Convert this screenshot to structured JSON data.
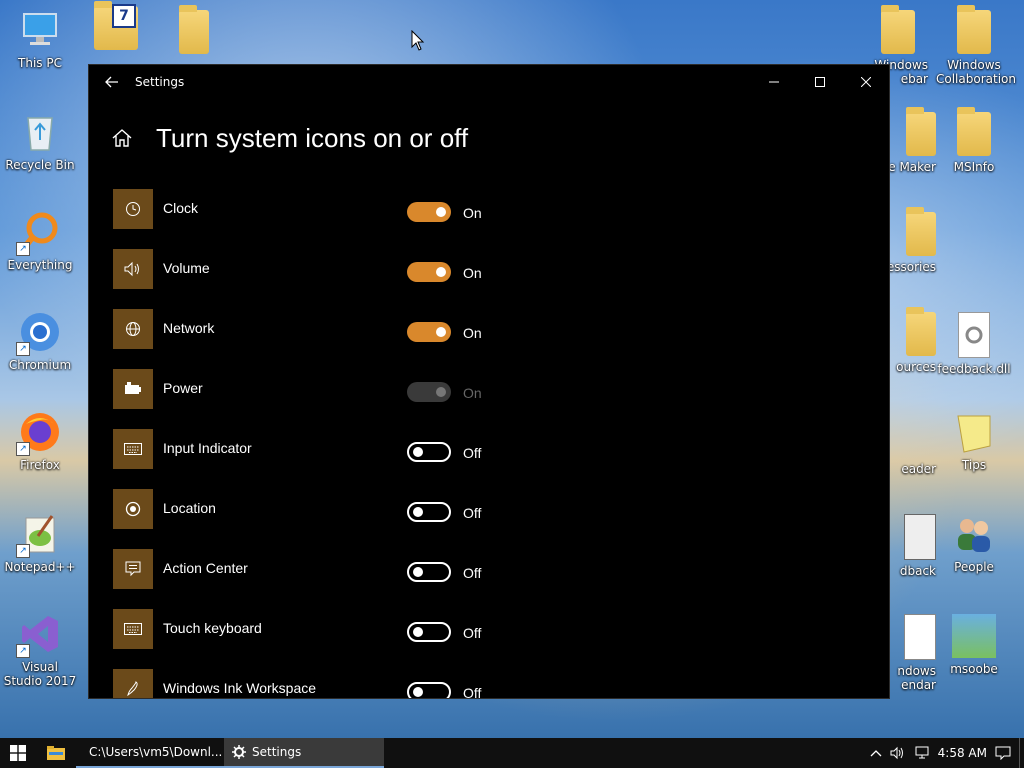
{
  "desktop": {
    "icons_left": [
      {
        "label": "This PC"
      },
      {
        "label": "Recycle Bin"
      },
      {
        "label": "Everything"
      },
      {
        "label": "Chromium"
      },
      {
        "label": "Firefox"
      },
      {
        "label": "Notepad++"
      },
      {
        "label": "Visual Studio 2017"
      }
    ],
    "icons_right": [
      {
        "label": "Windows Sidebar",
        "visible_text": "Windows\nebar"
      },
      {
        "label": "Windows Collaboration"
      },
      {
        "label": "Movie Maker",
        "visible_text": "e Maker"
      },
      {
        "label": "MSInfo"
      },
      {
        "label": "Accessories",
        "visible_text": "essories"
      },
      {
        "label": "Resources",
        "visible_text": "ources"
      },
      {
        "label": "feedback.dll"
      },
      {
        "label": "Reader",
        "visible_text": "eader"
      },
      {
        "label": "Tips"
      },
      {
        "label": "Feedback",
        "visible_text": "dback"
      },
      {
        "label": "People"
      },
      {
        "label": "Windows Calendar",
        "visible_text": "ndows\nendar"
      },
      {
        "label": "msoobe"
      }
    ]
  },
  "window": {
    "title": "Settings",
    "page_title": "Turn system icons on or off",
    "items": [
      {
        "label": "Clock",
        "icon": "clock-icon",
        "state": "On",
        "toggle": "on"
      },
      {
        "label": "Volume",
        "icon": "volume-icon",
        "state": "On",
        "toggle": "on"
      },
      {
        "label": "Network",
        "icon": "globe-icon",
        "state": "On",
        "toggle": "on"
      },
      {
        "label": "Power",
        "icon": "battery-icon",
        "state": "On",
        "toggle": "disabled"
      },
      {
        "label": "Input Indicator",
        "icon": "keyboard-icon",
        "state": "Off",
        "toggle": "off"
      },
      {
        "label": "Location",
        "icon": "location-icon",
        "state": "Off",
        "toggle": "off"
      },
      {
        "label": "Action Center",
        "icon": "action-center-icon",
        "state": "Off",
        "toggle": "off"
      },
      {
        "label": "Touch keyboard",
        "icon": "keyboard-icon",
        "state": "Off",
        "toggle": "off"
      },
      {
        "label": "Windows Ink Workspace",
        "icon": "pen-icon",
        "state": "Off",
        "toggle": "off"
      }
    ]
  },
  "taskbar": {
    "apps": [
      {
        "label": "C:\\Users\\vm5\\Downl..."
      },
      {
        "label": "Settings"
      }
    ],
    "clock": "4:58 AM"
  },
  "colors": {
    "accent": "#d9882c",
    "tile": "#6b4a1a",
    "window_bg": "#000000",
    "taskbar_bg": "#101010"
  }
}
